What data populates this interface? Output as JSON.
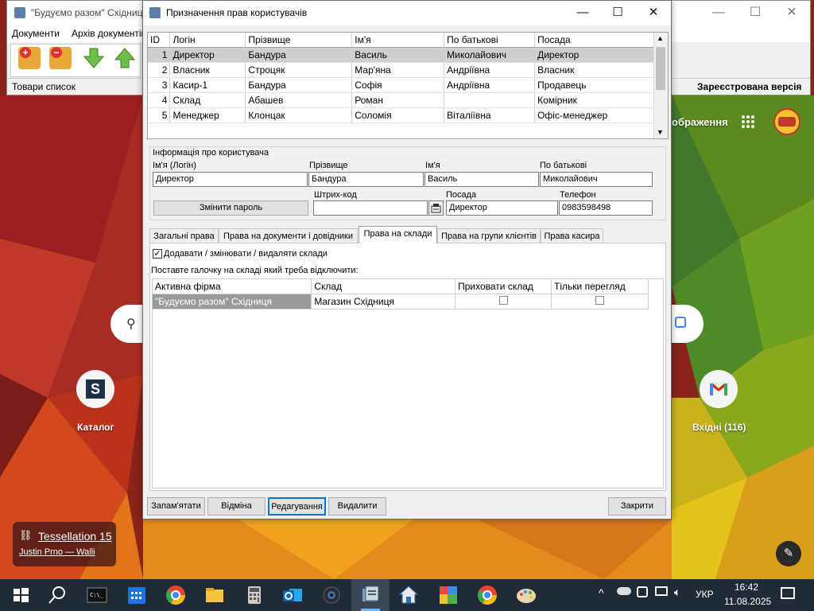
{
  "background_app": {
    "title": "\"Будуємо разом\" Східниця",
    "menu": [
      "Документи",
      "Архів документів"
    ],
    "status_left": "Товари список",
    "status_right": "Зареєстрована версія"
  },
  "dialog": {
    "title": "Призначення прав користувачів",
    "user_grid": {
      "columns": [
        "ID",
        "Логін",
        "Прізвище",
        "Ім'я",
        "По батькові",
        "Посада"
      ],
      "rows": [
        {
          "id": "1",
          "login": "Директор",
          "surname": "Бандура",
          "name": "Василь",
          "patronymic": "Миколайович",
          "position": "Директор"
        },
        {
          "id": "2",
          "login": "Власник",
          "surname": "Строцяк",
          "name": "Мар'яна",
          "patronymic": "Андріївна",
          "position": "Власник"
        },
        {
          "id": "3",
          "login": "Касир-1",
          "surname": "Бандура",
          "name": "Софія",
          "patronymic": "Андріївна",
          "position": "Продавець"
        },
        {
          "id": "4",
          "login": "Склад",
          "surname": "Абашев",
          "name": "Роман",
          "patronymic": "",
          "position": "Комірник"
        },
        {
          "id": "5",
          "login": "Менеджер",
          "surname": "Клонцак",
          "name": "Соломія",
          "patronymic": "Віталіївна",
          "position": "Офіс-менеджер"
        }
      ]
    },
    "user_info": {
      "group_title": "Інформація про користувача",
      "login_label": "Ім'я (Логін)",
      "login_value": "Директор",
      "surname_label": "Прізвище",
      "surname_value": "Бандура",
      "name_label": "Ім'я",
      "name_value": "Василь",
      "patronymic_label": "По батькові",
      "patronymic_value": "Миколайович",
      "change_password": "Змінити пароль",
      "barcode_label": "Штрих-код",
      "barcode_value": "",
      "position_label": "Посада",
      "position_value": "Директор",
      "phone_label": "Телефон",
      "phone_value": "0983598498"
    },
    "tabs": [
      "Загальні права",
      "Права на документи і довідники",
      "Права на склади",
      "Права на групи клієнтів",
      "Права касира"
    ],
    "active_tab": "Права на склади",
    "warehouse_tab": {
      "checkbox_label": "Додавати / змінювати / видаляти склади",
      "checkbox_checked": true,
      "hint": "Поставте галочку на складі який треба відключити:",
      "columns": [
        "Активна фірма",
        "Склад",
        "Приховати склад",
        "Тільки перегляд"
      ],
      "rows": [
        {
          "firm": "\"Будуємо разом\" Східниця",
          "warehouse": "Магазин Східниця",
          "hide": false,
          "view_only": false
        }
      ]
    },
    "buttons": {
      "save": "Запам'ятати",
      "cancel": "Відміна",
      "edit": "Редагування",
      "delete": "Видалити",
      "close": "Закрити"
    }
  },
  "desktop": {
    "shortcut_left": "Каталог",
    "shortcut_right": "Вхідні (116)",
    "images_label": "ображення",
    "wallpaper_title": "Tessellation 15",
    "wallpaper_author": "Justin Prno — Walli"
  },
  "taskbar": {
    "language": "УКР",
    "time": "16:42",
    "date": "11.08.2025"
  }
}
